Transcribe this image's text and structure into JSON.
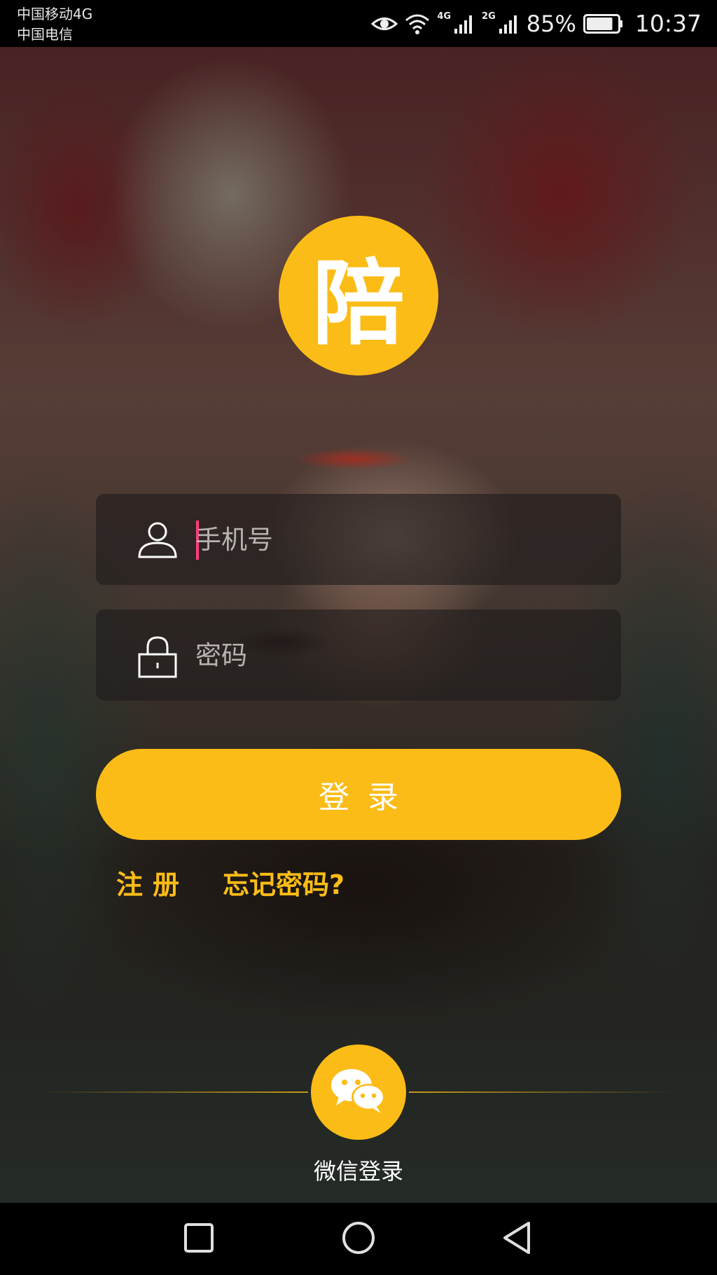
{
  "status_bar": {
    "carrier_1": "中国移动4G",
    "carrier_2": "中国电信",
    "net_1": "4G",
    "net_2": "2G",
    "battery": "85%",
    "battery_level": 0.85,
    "time": "10:37"
  },
  "logo": {
    "text": "陪",
    "color": "#fbbc17"
  },
  "form": {
    "phone_placeholder": "手机号",
    "phone_value": "",
    "phone_icon": "user-icon",
    "password_placeholder": "密码",
    "password_value": "",
    "password_icon": "lock-icon",
    "caret_color": "#ff3d7f"
  },
  "actions": {
    "login_label": "登录",
    "register_label": "注册",
    "forgot_label": "忘记密码?"
  },
  "social": {
    "wechat_label": "微信登录",
    "wechat_icon": "wechat-icon"
  },
  "nav": {
    "recent_icon": "square-icon",
    "home_icon": "circle-icon",
    "back_icon": "triangle-back-icon"
  },
  "colors": {
    "accent": "#fbbc17",
    "text": "#ffffff"
  }
}
